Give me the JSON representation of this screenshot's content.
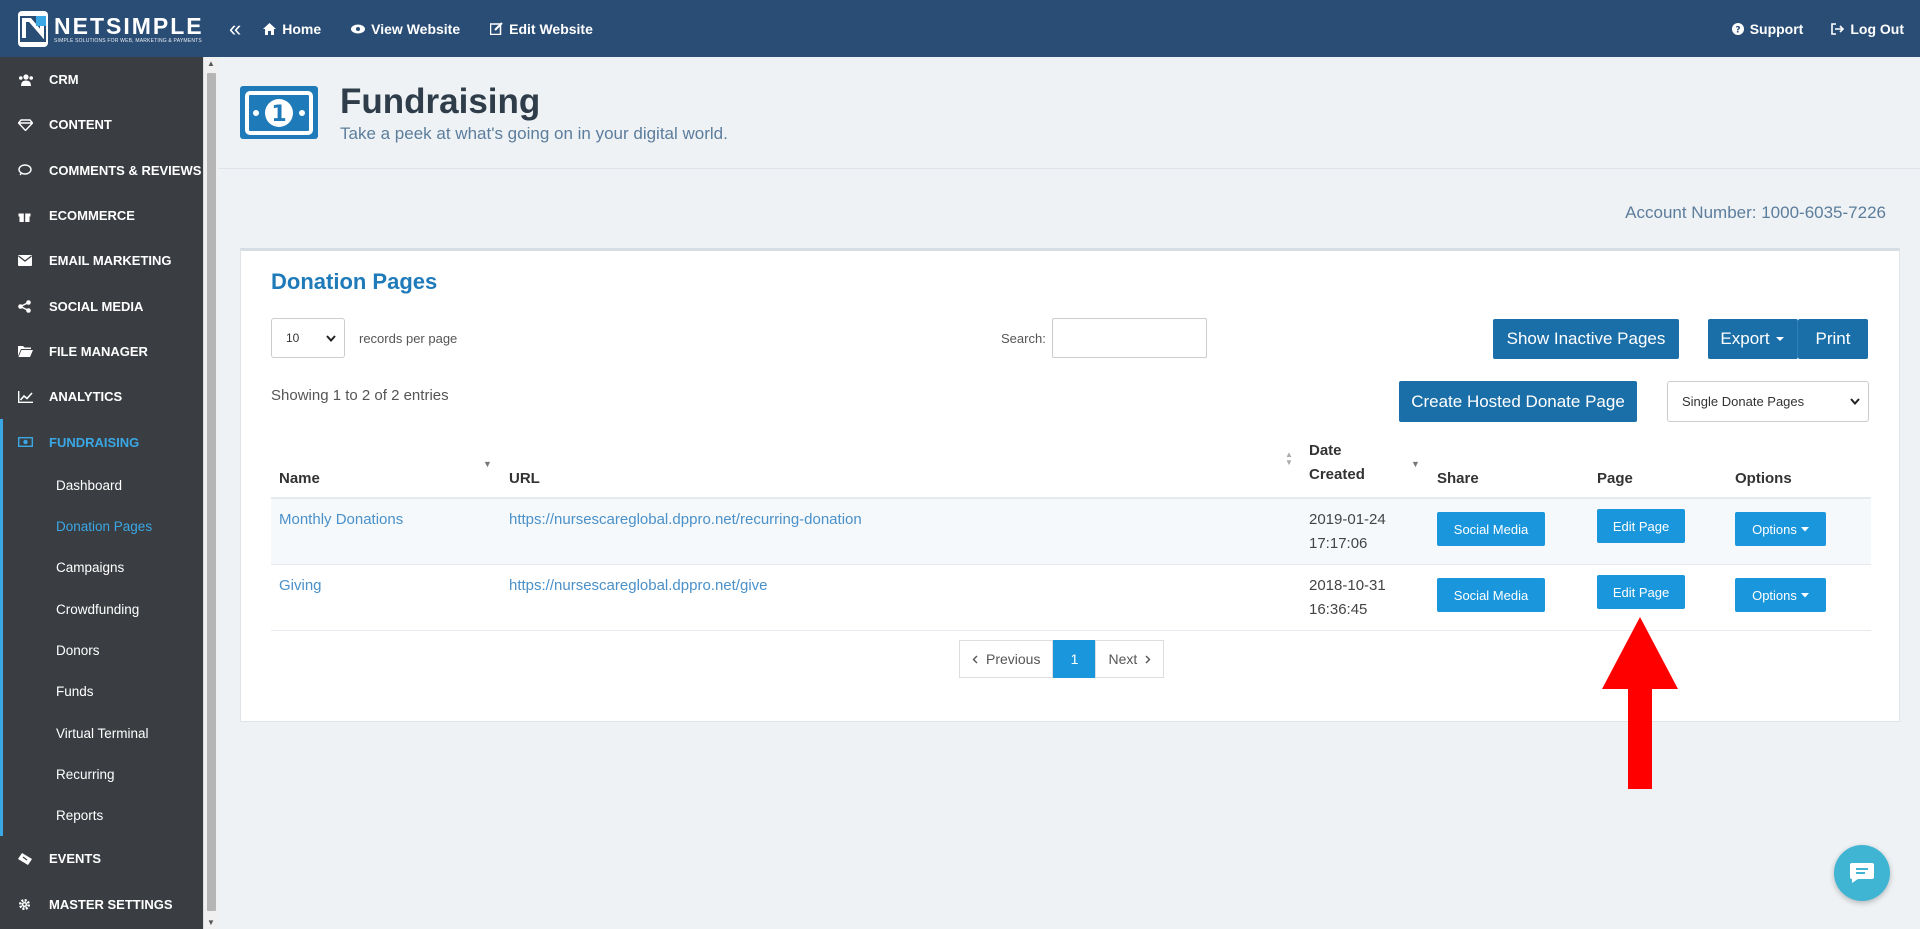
{
  "topbar": {
    "logo_name": "NETSIMPLE",
    "logo_tag": "SIMPLE SOLUTIONS FOR WEB, MARKETING & PAYMENTS",
    "nav": [
      {
        "label": "Home",
        "icon": "home-icon"
      },
      {
        "label": "View Website",
        "icon": "eye-icon"
      },
      {
        "label": "Edit Website",
        "icon": "edit-icon"
      }
    ],
    "support": "Support",
    "logout": "Log Out"
  },
  "sidebar": {
    "items_top": [
      {
        "label": "CRM",
        "icon": "users-icon"
      },
      {
        "label": "CONTENT",
        "icon": "diamond-icon"
      },
      {
        "label": "COMMENTS & REVIEWS",
        "icon": "comment-icon"
      },
      {
        "label": "ECOMMERCE",
        "icon": "gift-icon"
      },
      {
        "label": "EMAIL MARKETING",
        "icon": "envelope-icon"
      },
      {
        "label": "SOCIAL MEDIA",
        "icon": "share-icon"
      },
      {
        "label": "FILE MANAGER",
        "icon": "folder-icon"
      },
      {
        "label": "ANALYTICS",
        "icon": "chart-icon"
      },
      {
        "label": "FUNDRAISING",
        "icon": "money-icon"
      }
    ],
    "sub_items": [
      "Dashboard",
      "Donation Pages",
      "Campaigns",
      "Crowdfunding",
      "Donors",
      "Funds",
      "Virtual Terminal",
      "Recurring",
      "Reports"
    ],
    "items_bottom": [
      {
        "label": "EVENTS",
        "icon": "ticket-icon"
      },
      {
        "label": "MASTER SETTINGS",
        "icon": "cog-icon"
      }
    ]
  },
  "header": {
    "title": "Fundraising",
    "subtitle": "Take a peek at what's going on in your digital world."
  },
  "account": "Account Number: 1000-6035-7226",
  "panel": {
    "title": "Donation Pages",
    "records_value": "10",
    "records_label": "records per page",
    "search_label": "Search:",
    "show_inactive": "Show Inactive Pages",
    "export": "Export",
    "print": "Print",
    "create": "Create Hosted Donate Page",
    "type_select": "Single Donate Pages",
    "entries": "Showing 1 to 2 of 2 entries",
    "columns": {
      "name": "Name",
      "url": "URL",
      "date_line1": "Date",
      "date_line2": "Created",
      "share": "Share",
      "page": "Page",
      "options": "Options"
    },
    "rows": [
      {
        "name": "Monthly Donations",
        "url": "https://nursescareglobal.dppro.net/recurring-donation",
        "date": "2019-01-24",
        "time": "17:17:06",
        "share": "Social Media",
        "page": "Edit Page",
        "options": "Options"
      },
      {
        "name": "Giving",
        "url": "https://nursescareglobal.dppro.net/give",
        "date": "2018-10-31",
        "time": "16:36:45",
        "share": "Social Media",
        "page": "Edit Page",
        "options": "Options"
      }
    ],
    "pager": {
      "previous": "Previous",
      "current": "1",
      "next": "Next"
    }
  },
  "colors": {
    "topbar": "#2a4d75",
    "sidebar": "#3a3d42",
    "accent": "#1a96dc",
    "dark_button": "#1b6fa8",
    "arrow": "#ff0000"
  }
}
